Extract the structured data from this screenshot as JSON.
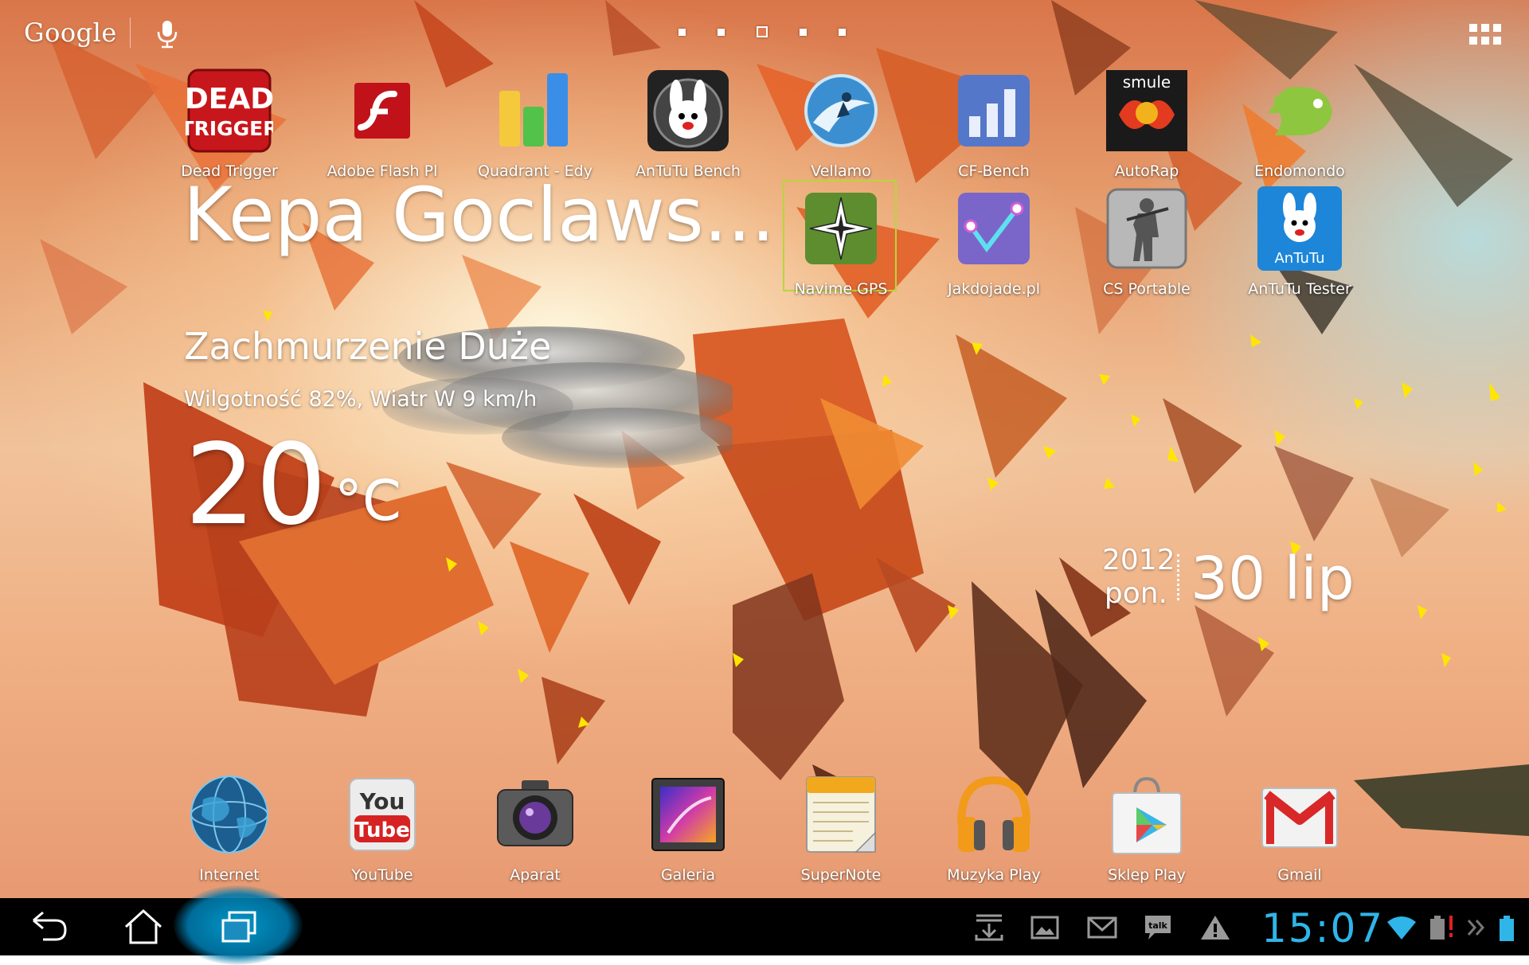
{
  "search": {
    "brand": "Google"
  },
  "pages": {
    "count": 5,
    "current": 3
  },
  "apps": [
    {
      "label": "Dead Trigger",
      "icon": "dead-trigger-icon"
    },
    {
      "label": "Adobe Flash Pl",
      "icon": "flash-icon"
    },
    {
      "label": "Quadrant - Edy",
      "icon": "quadrant-icon"
    },
    {
      "label": "AnTuTu Bench",
      "icon": "antutu-bench-icon"
    },
    {
      "label": "Vellamo",
      "icon": "vellamo-icon"
    },
    {
      "label": "CF-Bench",
      "icon": "cf-bench-icon"
    },
    {
      "label": "AutoRap",
      "icon": "autorap-icon"
    },
    {
      "label": "Endomondo",
      "icon": "endomondo-icon"
    },
    {
      "label": "Navime GPS",
      "icon": "navime-gps-icon"
    },
    {
      "label": "Jakdojade.pl",
      "icon": "jakdojade-icon"
    },
    {
      "label": "CS Portable",
      "icon": "cs-portable-icon"
    },
    {
      "label": "AnTuTu Tester",
      "icon": "antutu-tester-icon"
    }
  ],
  "dock": [
    {
      "label": "Internet",
      "icon": "internet-globe-icon"
    },
    {
      "label": "YouTube",
      "icon": "youtube-icon"
    },
    {
      "label": "Aparat",
      "icon": "camera-icon"
    },
    {
      "label": "Galeria",
      "icon": "gallery-icon"
    },
    {
      "label": "SuperNote",
      "icon": "supernote-icon"
    },
    {
      "label": "Muzyka Play",
      "icon": "headphones-icon"
    },
    {
      "label": "Sklep Play",
      "icon": "play-store-icon"
    },
    {
      "label": "Gmail",
      "icon": "gmail-icon"
    }
  ],
  "icon_text": {
    "dead_trigger_line1": "DEAD",
    "dead_trigger_line2": "TRIGGER",
    "autorap_brand": "smule",
    "antutu_tester_text": "AnTuTu",
    "youtube_you": "You",
    "youtube_tube": "Tube",
    "talk": "talk"
  },
  "weather": {
    "location": "Kepa Goclaws...",
    "condition": "Zachmurzenie Duże",
    "details": "Wilgotność 82%, Wiatr W 9 km/h",
    "temperature": "20",
    "unit": "°C"
  },
  "date": {
    "year": "2012",
    "day_of_week": "pon.",
    "day_month": "30 lip"
  },
  "status": {
    "time": "15:07"
  },
  "colors": {
    "clock": "#2fb5e8",
    "nav_glow": "#00a0d2",
    "selection": "#b6d63b"
  }
}
